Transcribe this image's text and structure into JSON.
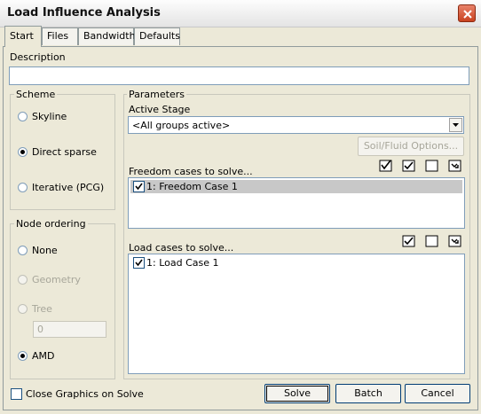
{
  "window": {
    "title": "Load Influence Analysis"
  },
  "tabs": [
    "Start",
    "Files",
    "Bandwidth",
    "Defaults"
  ],
  "description": {
    "label": "Description",
    "value": ""
  },
  "scheme": {
    "label": "Scheme",
    "options": [
      "Skyline",
      "Direct sparse",
      "Iterative (PCG)"
    ],
    "selected": "Direct sparse"
  },
  "node_ordering": {
    "label": "Node ordering",
    "options": [
      "None",
      "Geometry",
      "Tree",
      "AMD"
    ],
    "selected": "AMD",
    "tree_value": "0"
  },
  "parameters": {
    "label": "Parameters",
    "active_stage_label": "Active Stage",
    "active_stage_value": "<All groups active>",
    "soil_fluid_button": "Soil/Fluid Options...",
    "freedom_label": "Freedom cases to solve...",
    "freedom_items": [
      {
        "checked": true,
        "text": "1: Freedom Case 1"
      }
    ],
    "load_label": "Load cases to solve...",
    "load_items": [
      {
        "checked": true,
        "text": "1: Load Case 1"
      }
    ]
  },
  "footer": {
    "close_graphics_label": "Close Graphics on Solve",
    "close_graphics_checked": false,
    "solve_button": "Solve",
    "batch_button": "Batch",
    "cancel_button": "Cancel"
  }
}
